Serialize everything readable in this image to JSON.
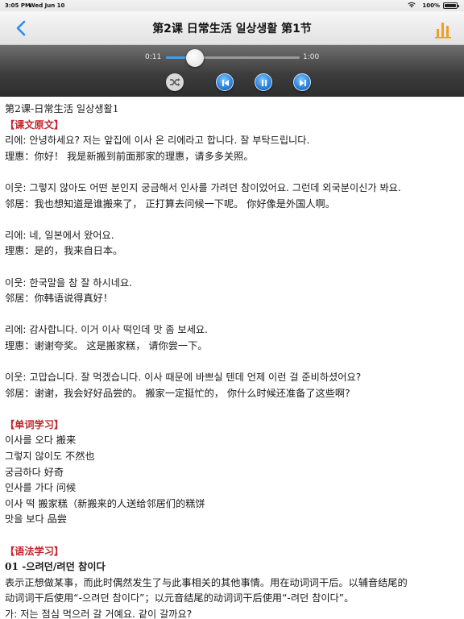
{
  "status_bar": {
    "time": "3:05 PM",
    "date": "Wed Jun 10",
    "battery": "100%"
  },
  "nav": {
    "title": "第2课 日常生活 일상생활 第1节",
    "back_icon": "chevron-left-icon",
    "menu_icon": "bar-chart-icon",
    "accent_color": "#2a8bf2",
    "menu_color": "#f0a020"
  },
  "player": {
    "current_time": "0:11",
    "total_time": "1:00",
    "progress_fraction": 0.18,
    "controls": [
      "shuffle-icon",
      "previous-icon",
      "pause-icon",
      "next-icon"
    ]
  },
  "content": {
    "heading": "第2课-日常生活 일상생활1",
    "section_text": "【课文原文】",
    "dialogue": [
      [
        "리에: 안녕하세요? 저는 앞집에 이사 온 리에라고 합니다. 잘 부탁드립니다.",
        "理惠：你好！ 我是新搬到前面那家的理惠，请多多关照。"
      ],
      [
        "이웃: 그렇지 않아도 어떤 분인지 궁금해서 인사를 가려던 참이었어요. 그런데 외국분이신가 봐요.",
        "邻居：我也想知道是谁搬来了， 正打算去问候一下呢。 你好像是外国人啊。"
      ],
      [
        "리에: 네, 일본에서 왔어요.",
        "理惠：是的，我来自日本。"
      ],
      [
        "이웃: 한국말을 참 잘 하시네요.",
        "邻居：你韩语说得真好！"
      ],
      [
        "리에: 감사합니다. 이거 이사 떡인데 맛 좀 보세요.",
        "理惠：谢谢夸奖。 这是搬家糕， 请你尝一下。"
      ],
      [
        "이웃: 고맙습니다. 잘 먹겠습니다. 이사 때문에 바쁘실 텐데 언제 이런 걸 준비하셨어요?",
        "邻居：谢谢，我会好好品尝的。 搬家一定挺忙的， 你什么时候还准备了这些啊?"
      ]
    ],
    "vocab_section": "【单词学习】",
    "vocab": [
      "이사를 오다  搬来",
      "그렇지 않이도  不然也",
      "궁금하다  好奇",
      "인사를 가다  问候",
      "이사 떡  搬家糕（新搬来的人送给邻居们的糕饼",
      "맛을 보다  品尝"
    ],
    "grammar_section": "【语法学习】",
    "grammar_title": "01 -으려던/려던 참이다",
    "grammar_desc_1": "表示正想做某事，而此时偶然发生了与此事相关的其他事情。用在动词词干后。以辅音结尾的",
    "grammar_desc_2": "动词词干后使用“-으려던 참이다”；以元音结尾的动词词干后使用“-려던 참이다”。",
    "grammar_example": "가: 저는 점심 먹으러 갈 거예요. 같이 갈까요?"
  }
}
